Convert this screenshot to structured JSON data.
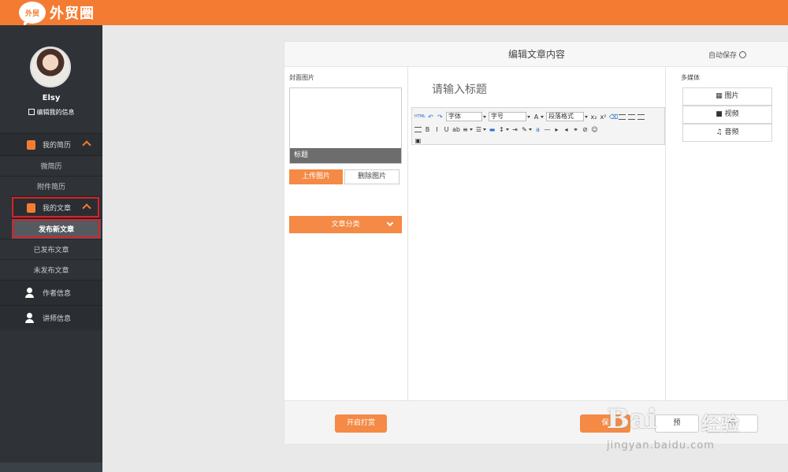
{
  "header": {
    "logo_badge": "外贸",
    "logo_text": "外贸圈"
  },
  "sidebar": {
    "user_name": "Elsy",
    "edit_info": "编辑我的信息",
    "menu": [
      {
        "type": "group",
        "label": "我的简历",
        "icon": "resume-icon",
        "expanded": true
      },
      {
        "type": "sub",
        "label": "微简历"
      },
      {
        "type": "sub",
        "label": "附件简历"
      },
      {
        "type": "group",
        "label": "我的文章",
        "icon": "article-icon",
        "expanded": true,
        "highlighted": true
      },
      {
        "type": "sub",
        "label": "发布新文章",
        "active": true
      },
      {
        "type": "sub",
        "label": "已发布文章"
      },
      {
        "type": "sub",
        "label": "未发布文章"
      },
      {
        "type": "person",
        "label": "作者信息",
        "icon": "author-icon"
      },
      {
        "type": "person",
        "label": "讲师信息",
        "icon": "lecturer-icon"
      }
    ]
  },
  "panel": {
    "title": "编辑文章内容",
    "autosave": "自动保存",
    "cover_label": "封面图片",
    "cover_caption": "标题",
    "upload_label": "上传图片",
    "delete_label": "删除图片",
    "category_label": "文章分类",
    "title_placeholder": "请输入标题",
    "toolbar": {
      "font_label": "字体",
      "size_label": "字号",
      "para_label": "段落格式",
      "html_label": "HTML"
    },
    "media_label": "多媒体",
    "media_buttons": [
      "图片",
      "视频",
      "音频"
    ]
  },
  "footer": {
    "reward_label": "开启打赏",
    "save_label": "保",
    "preview_label": "预",
    "publish_label": "布"
  },
  "watermark": {
    "main": "Bai",
    "cn": "经验",
    "sub": "jingyan.baidu.com"
  },
  "colors": {
    "brand": "#f47c32",
    "sidebar_bg": "#2f3237",
    "highlight_border": "#d8232a"
  }
}
